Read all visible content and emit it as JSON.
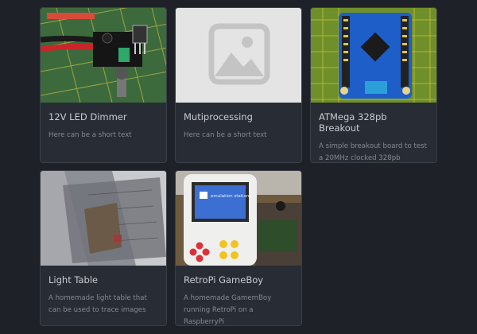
{
  "cards": [
    {
      "title": "12V LED Dimmer",
      "desc": "Here can be a short text",
      "image": "circuit-photo"
    },
    {
      "title": "Mutiprocessing",
      "desc": "Here can be a short text",
      "image": "image-placeholder-icon"
    },
    {
      "title": "ATMega 328pb Breakout",
      "desc": "A simple breakout board to test a 20MHz clocked 328pb",
      "image": "pcb-photo"
    },
    {
      "title": "Light Table",
      "desc": "A homemade light table that can be used to trace images",
      "image": "light-table-photo"
    },
    {
      "title": "RetroPi GameBoy",
      "desc": "A homemade GamemBoy running RetroPi on a RaspberryPi",
      "image": "gameboy-photo",
      "screen_text": "emulation station"
    }
  ]
}
